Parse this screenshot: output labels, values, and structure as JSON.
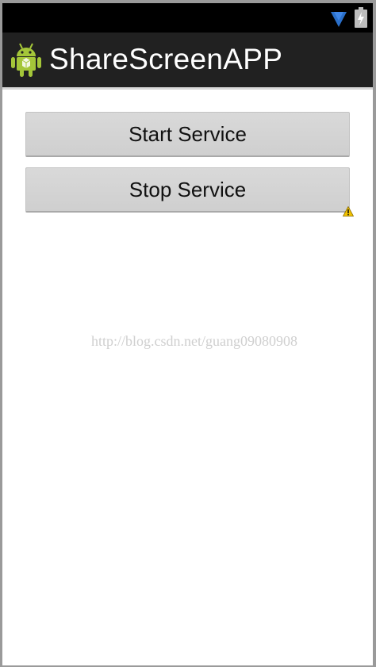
{
  "app": {
    "title": "ShareScreenAPP",
    "icon": "android-robot-icon"
  },
  "status_bar": {
    "icons": [
      "wifi-icon",
      "battery-charging-icon"
    ]
  },
  "buttons": {
    "start_label": "Start Service",
    "stop_label": "Stop Service"
  },
  "indicators": {
    "warning_icon": "warning-triangle-icon"
  },
  "watermark": {
    "text": "http://blog.csdn.net/guang09080908"
  },
  "colors": {
    "status_bar": "#000000",
    "action_bar": "#212121",
    "content_bg": "#ffffff",
    "button_bg": "#d4d4d4",
    "button_text": "#111111",
    "title_text": "#ffffff",
    "android_green": "#a4c639",
    "wifi_blue": "#2a6fc9"
  }
}
